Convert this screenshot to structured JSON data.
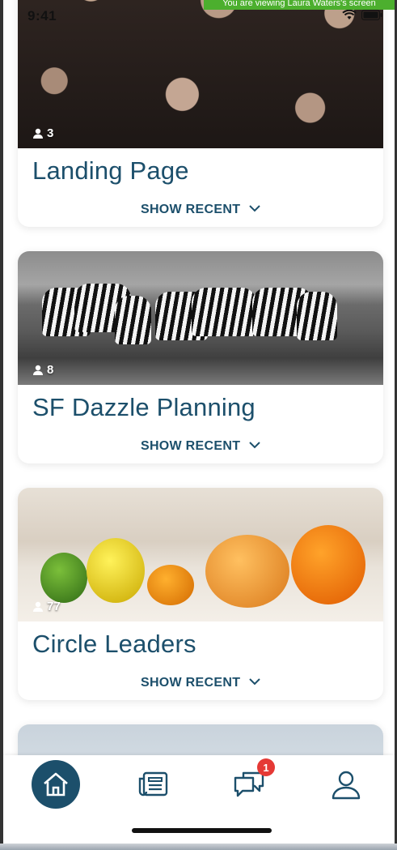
{
  "status_bar": {
    "time": "9:41",
    "share_banner": "You are viewing Laura Waters's screen"
  },
  "groups": [
    {
      "title": "Landing Page",
      "members": "3",
      "show_recent_label": "SHOW RECENT"
    },
    {
      "title": "SF Dazzle Planning",
      "members": "8",
      "show_recent_label": "SHOW RECENT"
    },
    {
      "title": "Circle Leaders",
      "members": "77",
      "show_recent_label": "SHOW RECENT"
    }
  ],
  "tabbar": {
    "chat_badge": "1",
    "active_tab": "home",
    "items": [
      "home-icon",
      "newspaper-icon",
      "chat-icon",
      "profile-icon"
    ]
  },
  "colors": {
    "primary": "#1c4f6b",
    "badge": "#e53935",
    "banner": "#4caf2e"
  }
}
